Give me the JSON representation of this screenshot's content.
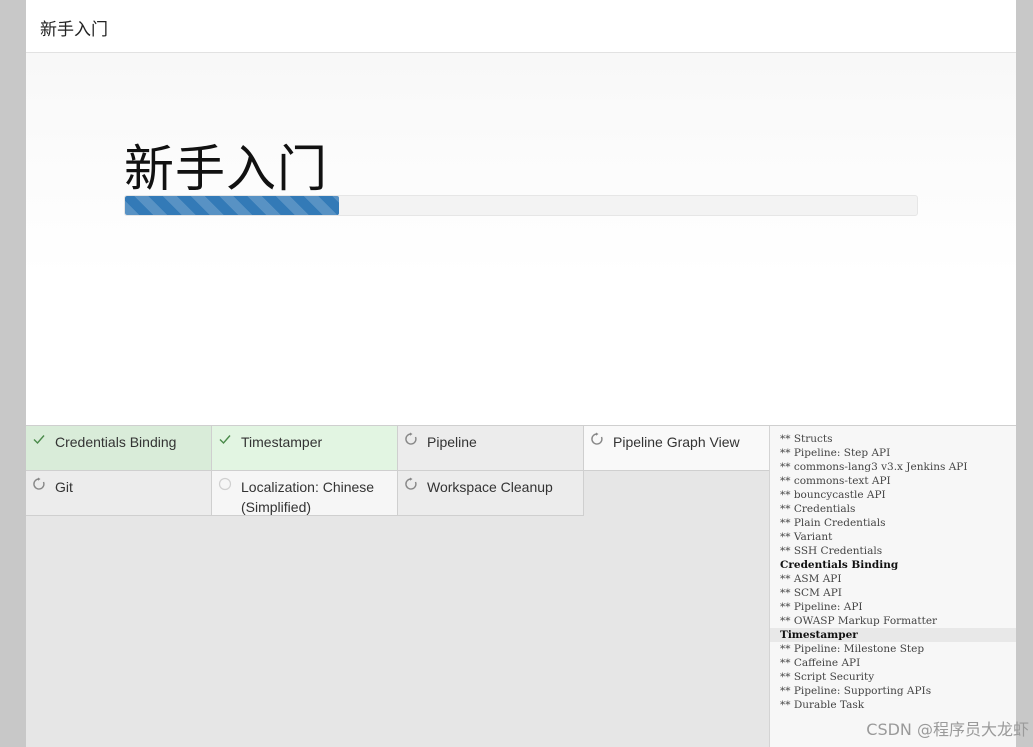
{
  "header": {
    "title": "新手入门"
  },
  "hero": {
    "title": "新手入门",
    "progress": 0.27
  },
  "plugins": [
    {
      "name": "Credentials Binding",
      "status": "success",
      "icon": "check-icon"
    },
    {
      "name": "Timestamper",
      "status": "success",
      "icon": "check-icon"
    },
    {
      "name": "Pipeline",
      "status": "installing",
      "icon": "refresh-icon"
    },
    {
      "name": "Pipeline Graph View",
      "status": "installing",
      "icon": "refresh-icon"
    },
    {
      "name": "Git",
      "status": "installing",
      "icon": "refresh-icon"
    },
    {
      "name": "Localization: Chinese (Simplified)",
      "status": "pending",
      "icon": "circle-icon"
    },
    {
      "name": "Workspace Cleanup",
      "status": "installing",
      "icon": "refresh-icon"
    }
  ],
  "log": [
    {
      "text": "** Structs",
      "strong": false
    },
    {
      "text": "** Pipeline: Step API",
      "strong": false
    },
    {
      "text": "** commons-lang3 v3.x Jenkins API",
      "strong": false
    },
    {
      "text": "** commons-text API",
      "strong": false
    },
    {
      "text": "** bouncycastle API",
      "strong": false
    },
    {
      "text": "** Credentials",
      "strong": false
    },
    {
      "text": "** Plain Credentials",
      "strong": false
    },
    {
      "text": "** Variant",
      "strong": false
    },
    {
      "text": "** SSH Credentials",
      "strong": false
    },
    {
      "text": "Credentials Binding",
      "strong": true
    },
    {
      "text": "** ASM API",
      "strong": false
    },
    {
      "text": "** SCM API",
      "strong": false
    },
    {
      "text": "** Pipeline: API",
      "strong": false
    },
    {
      "text": "** OWASP Markup Formatter",
      "strong": false
    },
    {
      "text": "Timestamper",
      "strong": true
    },
    {
      "text": "** Pipeline: Milestone Step",
      "strong": false
    },
    {
      "text": "** Caffeine API",
      "strong": false
    },
    {
      "text": "** Script Security",
      "strong": false
    },
    {
      "text": "** Pipeline: Supporting APIs",
      "strong": false
    },
    {
      "text": "** Durable Task",
      "strong": false
    }
  ],
  "watermark": "CSDN @程序员大龙虾",
  "colors": {
    "progress": "#337ab7",
    "success_bg": "#e2f5e2",
    "pending_bg": "#f6f6f6"
  }
}
